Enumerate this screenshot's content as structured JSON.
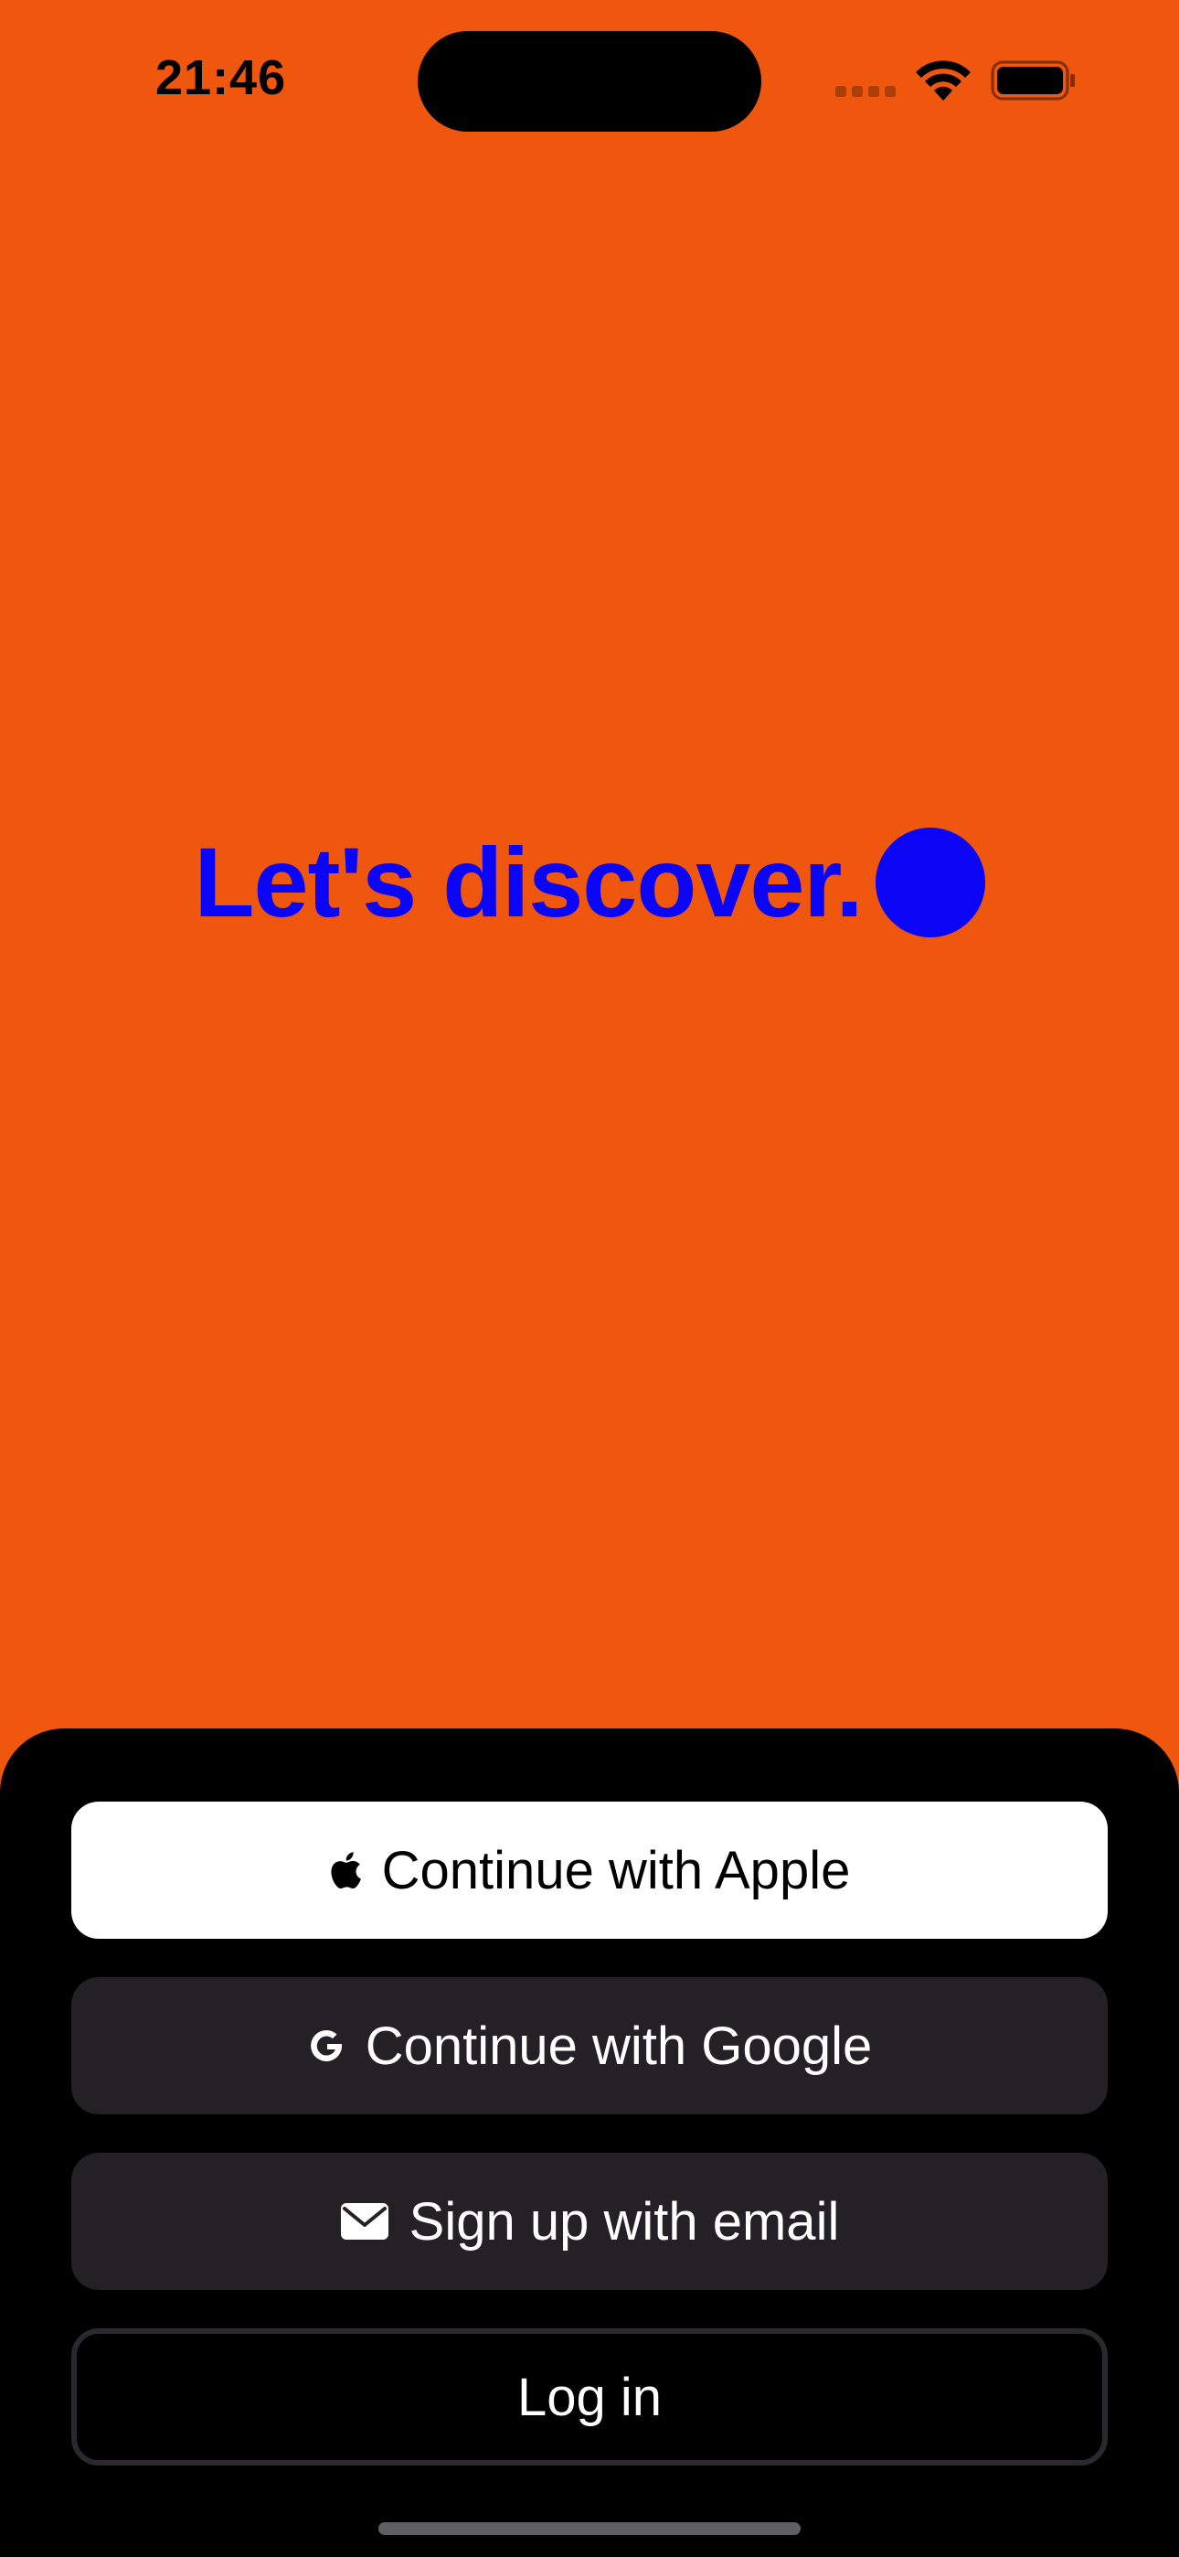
{
  "status_bar": {
    "time": "21:46",
    "icons": [
      "cellular-signal-icon",
      "wifi-icon",
      "battery-icon"
    ]
  },
  "hero": {
    "title": "Let's discover.",
    "accent_color": "#0A05F5",
    "background_color": "#EE570D"
  },
  "auth": {
    "apple_label": "Continue with Apple",
    "google_label": "Continue with Google",
    "email_label": "Sign up with email",
    "login_label": "Log in",
    "icons": {
      "apple": "apple-icon",
      "google": "google-icon",
      "email": "mail-icon"
    }
  }
}
